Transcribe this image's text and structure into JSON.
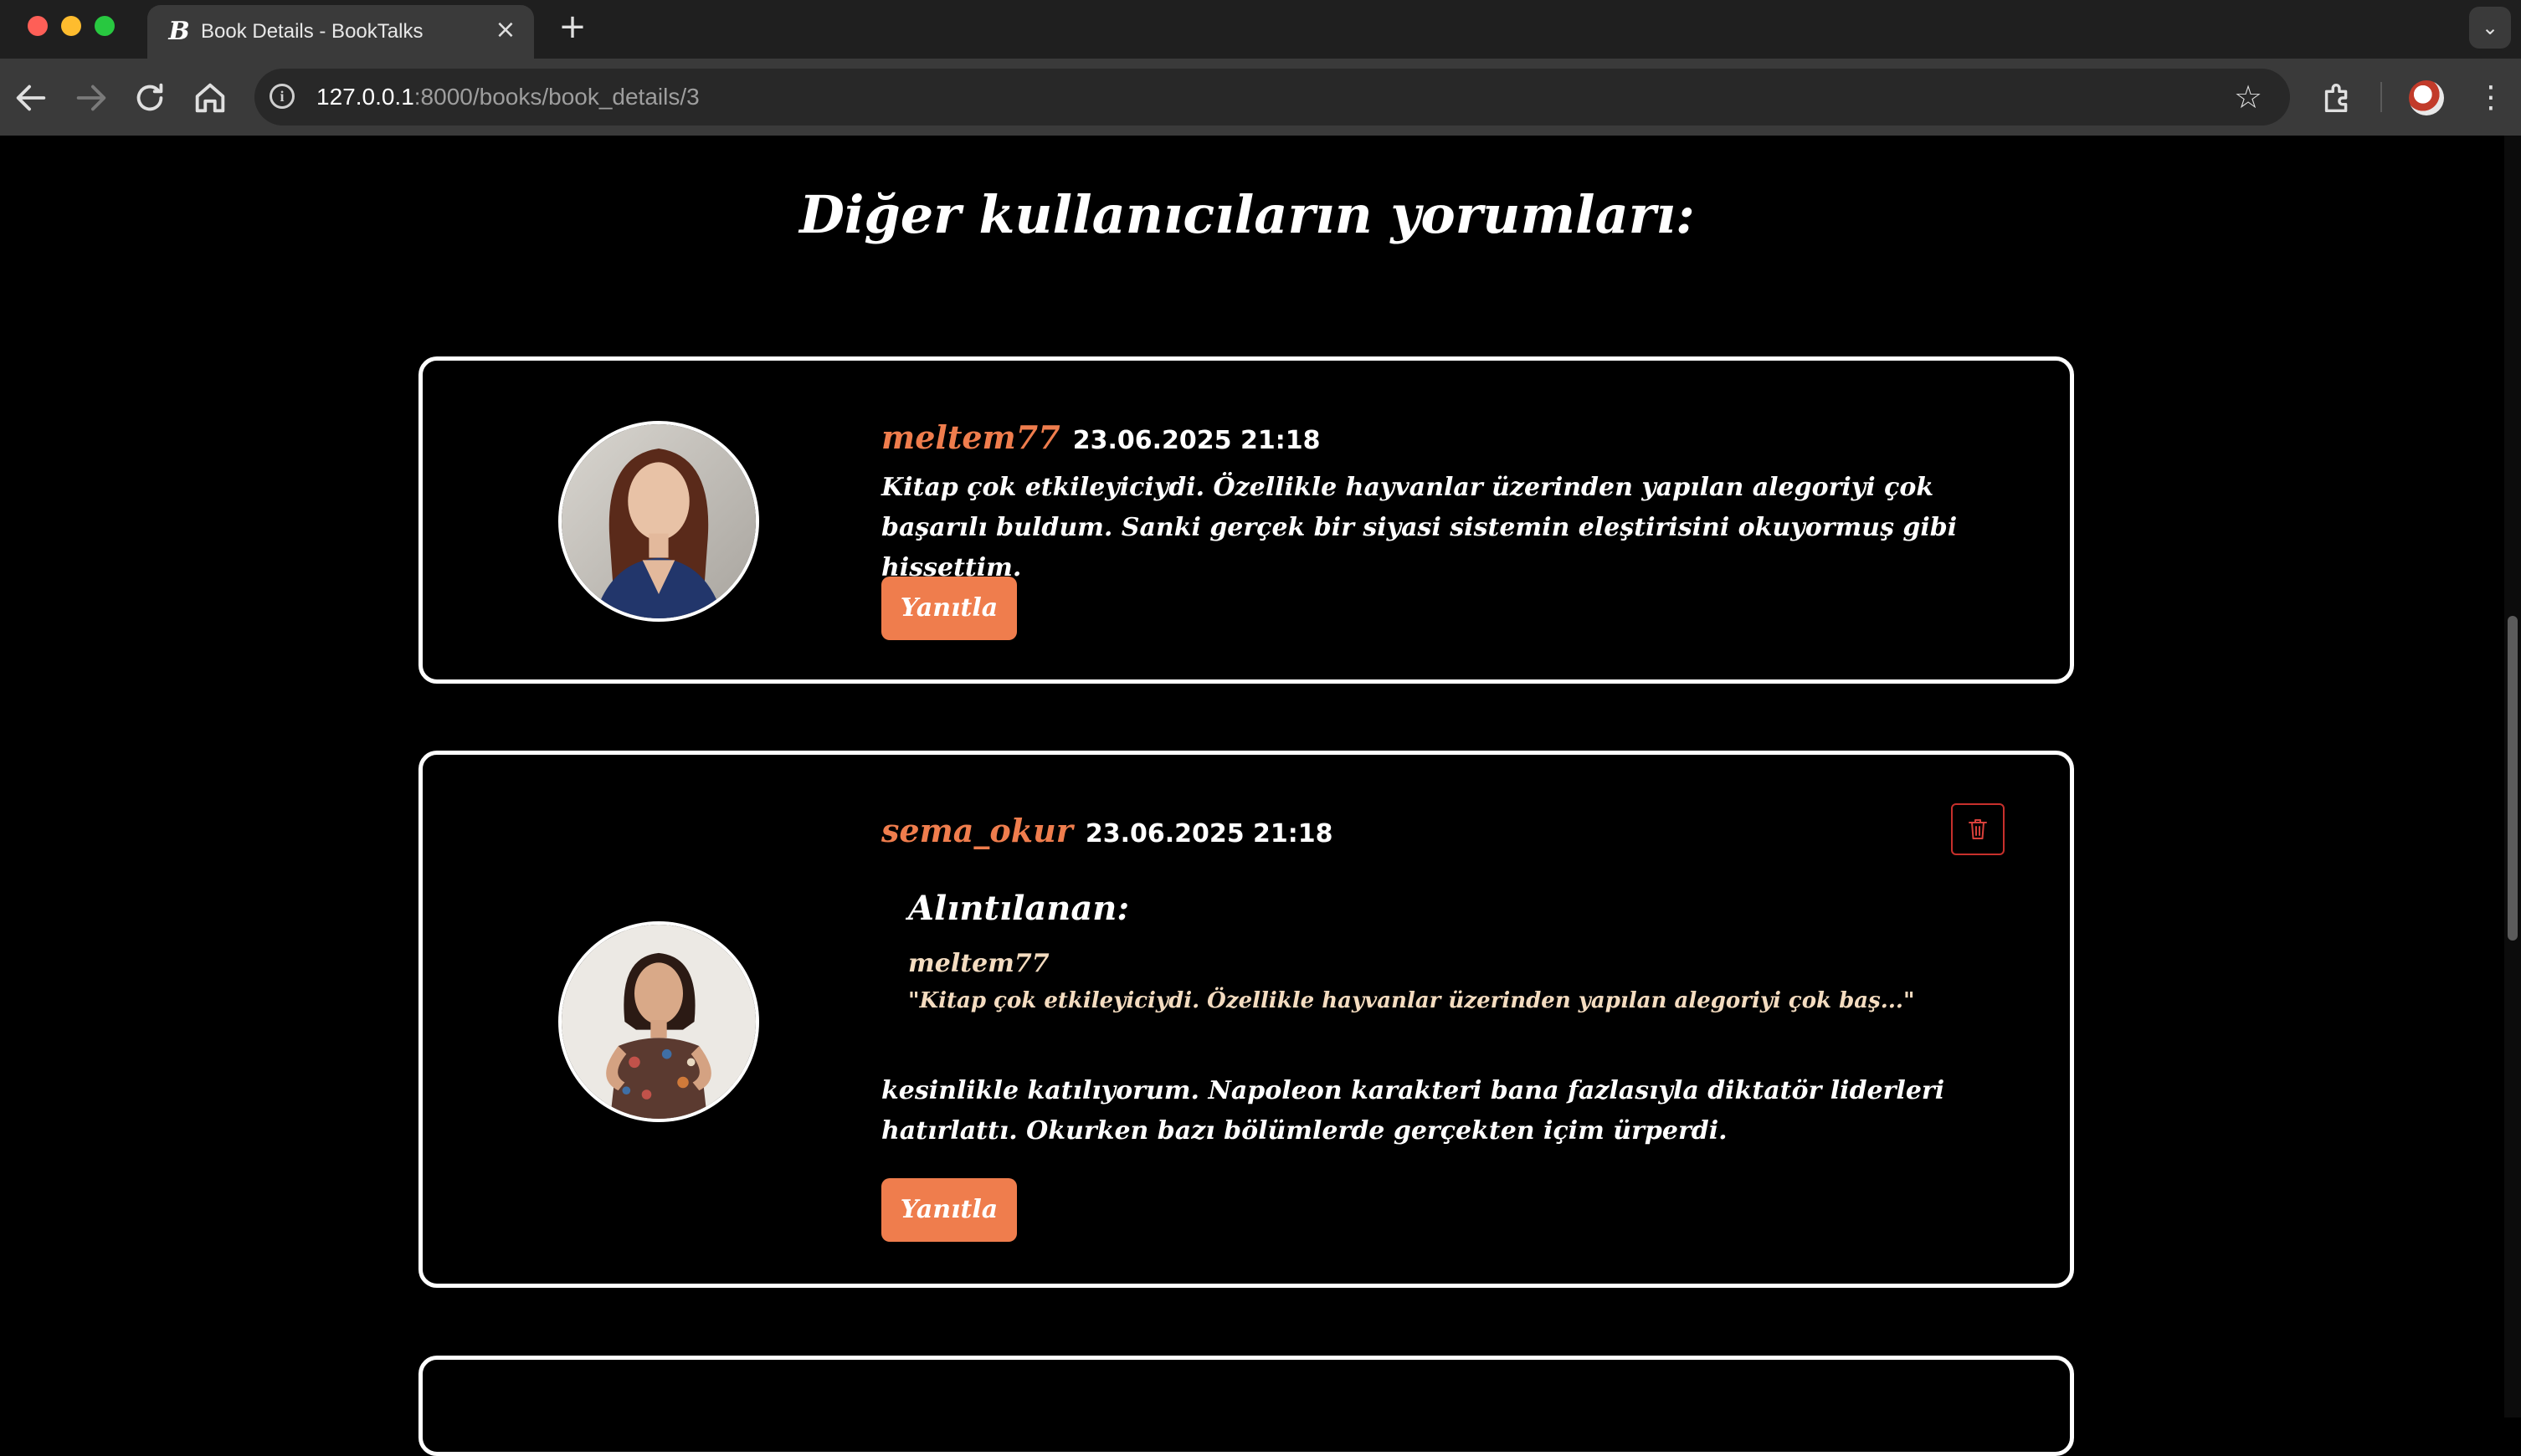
{
  "browser": {
    "tab_title": "Book Details - BookTalks",
    "tab_favicon": "B",
    "url_host": "127.0.0.1",
    "url_path": ":8000/books/book_details/3"
  },
  "page": {
    "section_title": "Diğer kullanıcıların yorumları:"
  },
  "comments": [
    {
      "username": "meltem77",
      "datetime": "23.06.2025 21:18",
      "text": "Kitap çok etkileyiciydi. Özellikle hayvanlar üzerinden yapılan alegoriyi çok başarılı buldum. Sanki gerçek bir siyasi sistemin eleştirisini okuyormuş gibi hissettim.",
      "reply_label": "Yanıtla"
    },
    {
      "username": "sema_okur",
      "datetime": "23.06.2025 21:18",
      "quote_label": "Alıntılanan:",
      "quote_user": "meltem77",
      "quote_text": "\"Kitap çok etkileyiciydi. Özellikle hayvanlar üzerinden yapılan alegoriyi çok baş...\"",
      "text": "kesinlikle katılıyorum. Napoleon karakteri bana fazlasıyla diktatör liderleri hatırlattı. Okurken bazı bölümlerde gerçekten içim ürperdi.",
      "reply_label": "Yanıtla",
      "delete_icon": "trash-icon"
    }
  ],
  "colors": {
    "accent": "#ef7d4d",
    "quote": "#f4dcc0",
    "delete": "#c8302c",
    "background": "#000000"
  }
}
